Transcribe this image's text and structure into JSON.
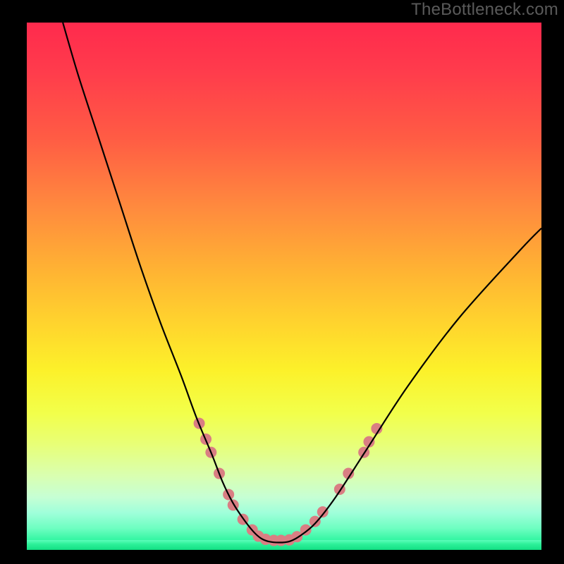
{
  "watermark_text": "TheBottleneck.com",
  "chart_data": {
    "type": "line",
    "title": "",
    "xlabel": "",
    "ylabel": "",
    "xlim": [
      0,
      100
    ],
    "ylim": [
      0,
      100
    ],
    "grid": false,
    "legend": "none",
    "background": {
      "type": "vertical-gradient",
      "stops": [
        {
          "pos": 0,
          "color": "#ff2a4d"
        },
        {
          "pos": 50,
          "color": "#ffd72d"
        },
        {
          "pos": 80,
          "color": "#e8ff77"
        },
        {
          "pos": 100,
          "color": "#18e58e"
        }
      ]
    },
    "series": [
      {
        "name": "bottleneck-curve",
        "color": "#000000",
        "stroke_width": 2.2,
        "x": [
          7,
          10,
          14,
          18,
          22,
          26,
          30,
          33,
          36,
          38,
          40,
          42,
          44,
          45.5,
          47,
          49,
          51,
          53,
          56,
          60,
          66,
          74,
          84,
          96,
          100
        ],
        "y": [
          100,
          90,
          78,
          66,
          54,
          43,
          33,
          25,
          18,
          13,
          9,
          6,
          3.5,
          2.2,
          1.6,
          1.4,
          1.6,
          2.6,
          5,
          10,
          19,
          31,
          44,
          57,
          61
        ]
      },
      {
        "name": "marker-dots",
        "type": "scatter",
        "color": "#d97e83",
        "radius": 8,
        "points": [
          {
            "x": 33.5,
            "y": 24
          },
          {
            "x": 34.8,
            "y": 21
          },
          {
            "x": 35.8,
            "y": 18.5
          },
          {
            "x": 37.4,
            "y": 14.5
          },
          {
            "x": 39.2,
            "y": 10.5
          },
          {
            "x": 40.1,
            "y": 8.5
          },
          {
            "x": 42.0,
            "y": 5.8
          },
          {
            "x": 43.8,
            "y": 3.8
          },
          {
            "x": 45.0,
            "y": 2.6
          },
          {
            "x": 46.4,
            "y": 2.0
          },
          {
            "x": 48.0,
            "y": 1.8
          },
          {
            "x": 49.4,
            "y": 1.8
          },
          {
            "x": 51.0,
            "y": 1.9
          },
          {
            "x": 52.5,
            "y": 2.5
          },
          {
            "x": 54.2,
            "y": 3.8
          },
          {
            "x": 56.0,
            "y": 5.4
          },
          {
            "x": 57.5,
            "y": 7.2
          },
          {
            "x": 60.8,
            "y": 11.5
          },
          {
            "x": 62.5,
            "y": 14.5
          },
          {
            "x": 65.5,
            "y": 18.5
          },
          {
            "x": 66.5,
            "y": 20.5
          },
          {
            "x": 68.0,
            "y": 23
          }
        ]
      }
    ]
  }
}
